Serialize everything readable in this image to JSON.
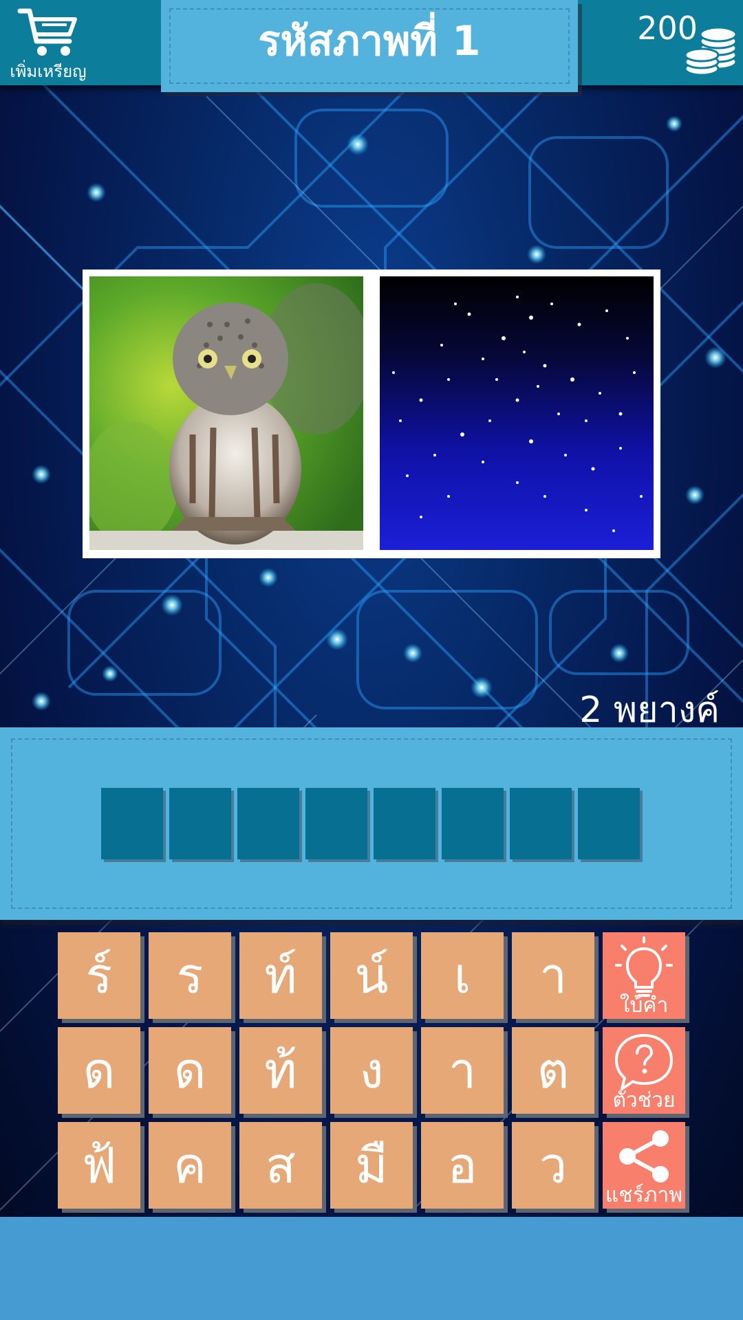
{
  "header": {
    "shop_label": "เพิ่มเหรียญ",
    "title": "รหัสภาพที่ 1",
    "coins": "200"
  },
  "puzzle": {
    "images": [
      "owl-icon",
      "starry-sky-icon"
    ],
    "hint_text": "2 พยางค์",
    "answer_slots": 8
  },
  "letters": [
    [
      "ร์",
      "ร",
      "ท์",
      "น์",
      "เ",
      "า"
    ],
    [
      "ด",
      "ด",
      "ท้",
      "ง",
      "า",
      "ต"
    ],
    [
      "ฟ้",
      "ค",
      "ส",
      "มื",
      "อ",
      "ว"
    ]
  ],
  "tools": {
    "clue_label": "ใบ้คำ",
    "help_label": "ตัวช่วย",
    "share_label": "แชร์ภาพ"
  },
  "colors": {
    "header": "#0d7d9c",
    "panel": "#54b3dd",
    "slot": "#076f92",
    "tile": "#e7a877",
    "tool": "#f77f6c",
    "footer": "#469bd3"
  }
}
